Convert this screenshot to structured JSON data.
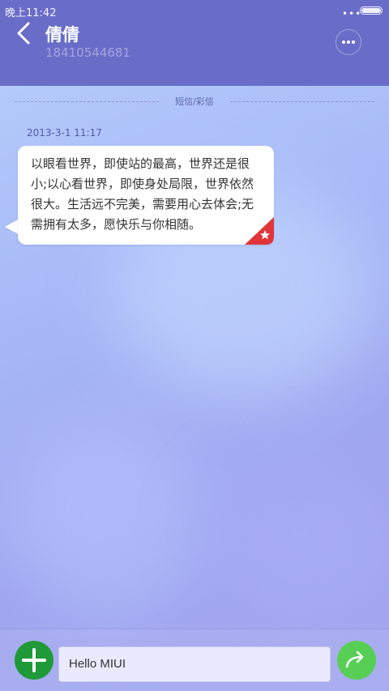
{
  "status_bar": {
    "time": "晚上11:42",
    "signal_dots": "•••",
    "battery_level": 1.0
  },
  "header": {
    "contact_name": "倩倩",
    "phone_number": "18410544681",
    "back_icon": "chevron-left-icon",
    "more_icon": "more-horizontal-icon"
  },
  "thread": {
    "channel_label": "短信/彩信",
    "messages": [
      {
        "timestamp": "2013-3-1 11:17",
        "text": "以眼看世界，即使站的最高，世界还是很小;以心看世界，即使身处局限，世界依然很大。生活远不完美，需要用心去体会;无需拥有太多，愿快乐与你相随。",
        "starred": true
      }
    ]
  },
  "composer": {
    "add_icon": "plus-icon",
    "input_value": "Hello MIUI",
    "send_icon": "send-arrow-icon"
  },
  "colors": {
    "header_bg": "#6a6dc7",
    "add_button": "#1f9a38",
    "send_button": "#57cf55",
    "star_badge": "#e0343a"
  }
}
